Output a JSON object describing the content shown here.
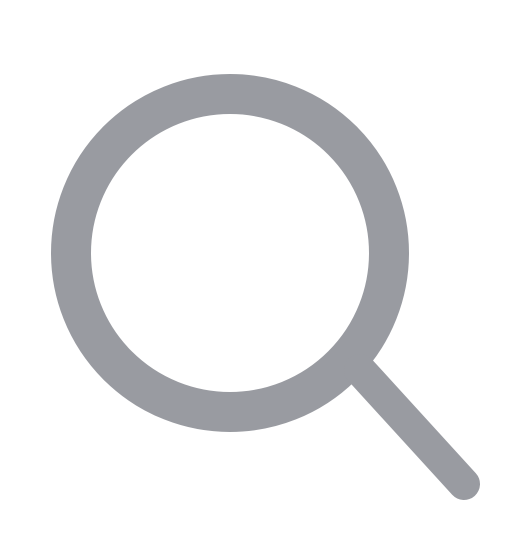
{
  "icon": {
    "name": "search-icon",
    "color": "#999ba1",
    "background": "#ffffff"
  }
}
